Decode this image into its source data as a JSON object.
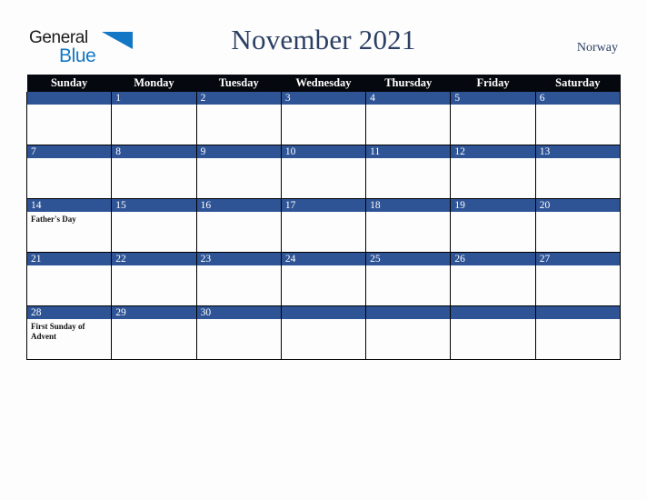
{
  "brand": {
    "name_top": "General",
    "name_bottom": "Blue",
    "triangle_icon": "blue-triangle-icon",
    "top_color": "#1a1a1a",
    "bottom_color": "#1277c4"
  },
  "header": {
    "title": "November 2021",
    "region": "Norway",
    "title_color": "#2b3f63"
  },
  "calendar": {
    "weekday_headers": [
      "Sunday",
      "Monday",
      "Tuesday",
      "Wednesday",
      "Thursday",
      "Friday",
      "Saturday"
    ],
    "header_bg": "#06080f",
    "header_text_color": "#ffffff",
    "daynum_bg": "#2e5496",
    "daynum_text_color": "#ffffff",
    "cell_bg": "#fdfdfd",
    "grid_line_color": "#000000",
    "weeks": [
      [
        {
          "day": "",
          "events": []
        },
        {
          "day": "1",
          "events": []
        },
        {
          "day": "2",
          "events": []
        },
        {
          "day": "3",
          "events": []
        },
        {
          "day": "4",
          "events": []
        },
        {
          "day": "5",
          "events": []
        },
        {
          "day": "6",
          "events": []
        }
      ],
      [
        {
          "day": "7",
          "events": []
        },
        {
          "day": "8",
          "events": []
        },
        {
          "day": "9",
          "events": []
        },
        {
          "day": "10",
          "events": []
        },
        {
          "day": "11",
          "events": []
        },
        {
          "day": "12",
          "events": []
        },
        {
          "day": "13",
          "events": []
        }
      ],
      [
        {
          "day": "14",
          "events": [
            "Father's Day"
          ]
        },
        {
          "day": "15",
          "events": []
        },
        {
          "day": "16",
          "events": []
        },
        {
          "day": "17",
          "events": []
        },
        {
          "day": "18",
          "events": []
        },
        {
          "day": "19",
          "events": []
        },
        {
          "day": "20",
          "events": []
        }
      ],
      [
        {
          "day": "21",
          "events": []
        },
        {
          "day": "22",
          "events": []
        },
        {
          "day": "23",
          "events": []
        },
        {
          "day": "24",
          "events": []
        },
        {
          "day": "25",
          "events": []
        },
        {
          "day": "26",
          "events": []
        },
        {
          "day": "27",
          "events": []
        }
      ],
      [
        {
          "day": "28",
          "events": [
            "First Sunday of Advent"
          ]
        },
        {
          "day": "29",
          "events": []
        },
        {
          "day": "30",
          "events": []
        },
        {
          "day": "",
          "events": []
        },
        {
          "day": "",
          "events": []
        },
        {
          "day": "",
          "events": []
        },
        {
          "day": "",
          "events": []
        }
      ]
    ]
  }
}
